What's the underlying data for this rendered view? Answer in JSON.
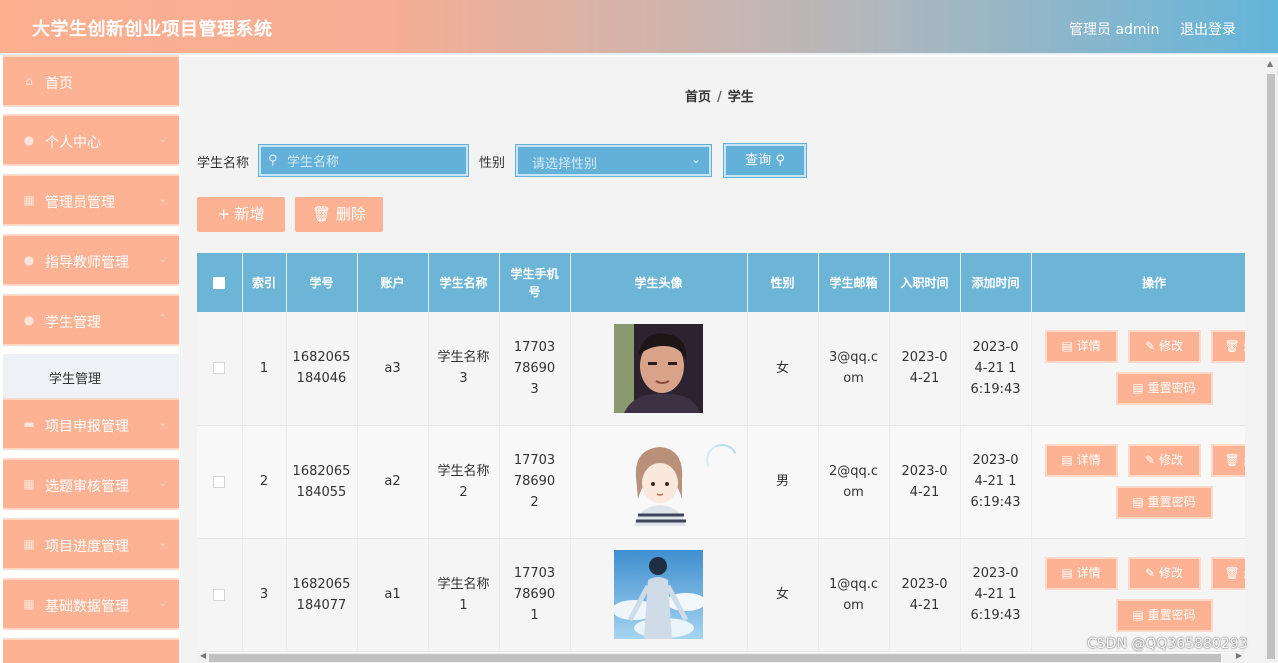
{
  "header": {
    "title": "大学生创新创业项目管理系统",
    "admin_label": "管理员 admin",
    "logout_label": "退出登录"
  },
  "sidebar": {
    "items": [
      {
        "label": "首页",
        "icon": "home-icon"
      },
      {
        "label": "个人中心",
        "icon": "user-icon"
      },
      {
        "label": "管理员管理",
        "icon": "grid-icon"
      },
      {
        "label": "指导教师管理",
        "icon": "user-icon"
      },
      {
        "label": "学生管理",
        "icon": "user-icon"
      },
      {
        "label": "项目申报管理",
        "icon": "chat-icon"
      },
      {
        "label": "选题审核管理",
        "icon": "grid-icon"
      },
      {
        "label": "项目进度管理",
        "icon": "grid-icon"
      },
      {
        "label": "基础数据管理",
        "icon": "grid-icon"
      }
    ],
    "submenu_item": "学生管理"
  },
  "breadcrumb": {
    "home": "首页",
    "separator": "/",
    "current": "学生"
  },
  "search": {
    "name_label": "学生名称",
    "name_placeholder": "学生名称",
    "gender_label": "性别",
    "gender_placeholder": "请选择性别",
    "query_label": "查询"
  },
  "actions": {
    "add_label": "新增",
    "delete_label": "删除"
  },
  "table": {
    "headers": [
      "索引",
      "学号",
      "账户",
      "学生名称",
      "学生手机号",
      "学生头像",
      "性别",
      "学生邮箱",
      "入职时间",
      "添加时间",
      "操作"
    ],
    "rows": [
      {
        "index": "1",
        "student_no": "1682065184046",
        "account": "a3",
        "name": "学生名称3",
        "phone": "17703786903",
        "avatar": "photo-male",
        "gender": "女",
        "email": "3@qq.com",
        "hire_date": "2023-04-21",
        "added": "2023-04-21 16:19:43"
      },
      {
        "index": "2",
        "student_no": "1682065184055",
        "account": "a2",
        "name": "学生名称2",
        "phone": "17703786902",
        "avatar": "cartoon-girl",
        "gender": "男",
        "email": "2@qq.com",
        "hire_date": "2023-04-21",
        "added": "2023-04-21 16:19:43"
      },
      {
        "index": "3",
        "student_no": "1682065184077",
        "account": "a1",
        "name": "学生名称1",
        "phone": "17703786901",
        "avatar": "anime-sky",
        "gender": "女",
        "email": "1@qq.com",
        "hire_date": "2023-04-21",
        "added": "2023-04-21 16:19:43"
      }
    ],
    "row_actions": {
      "detail": "详情",
      "edit": "修改",
      "delete": "删",
      "reset_password": "重置密码"
    }
  },
  "watermark": "CSDN @QQ365880293",
  "colors": {
    "accent": "#fdb293",
    "blue": "#63b0d8",
    "header_blue": "#6db5d6"
  }
}
